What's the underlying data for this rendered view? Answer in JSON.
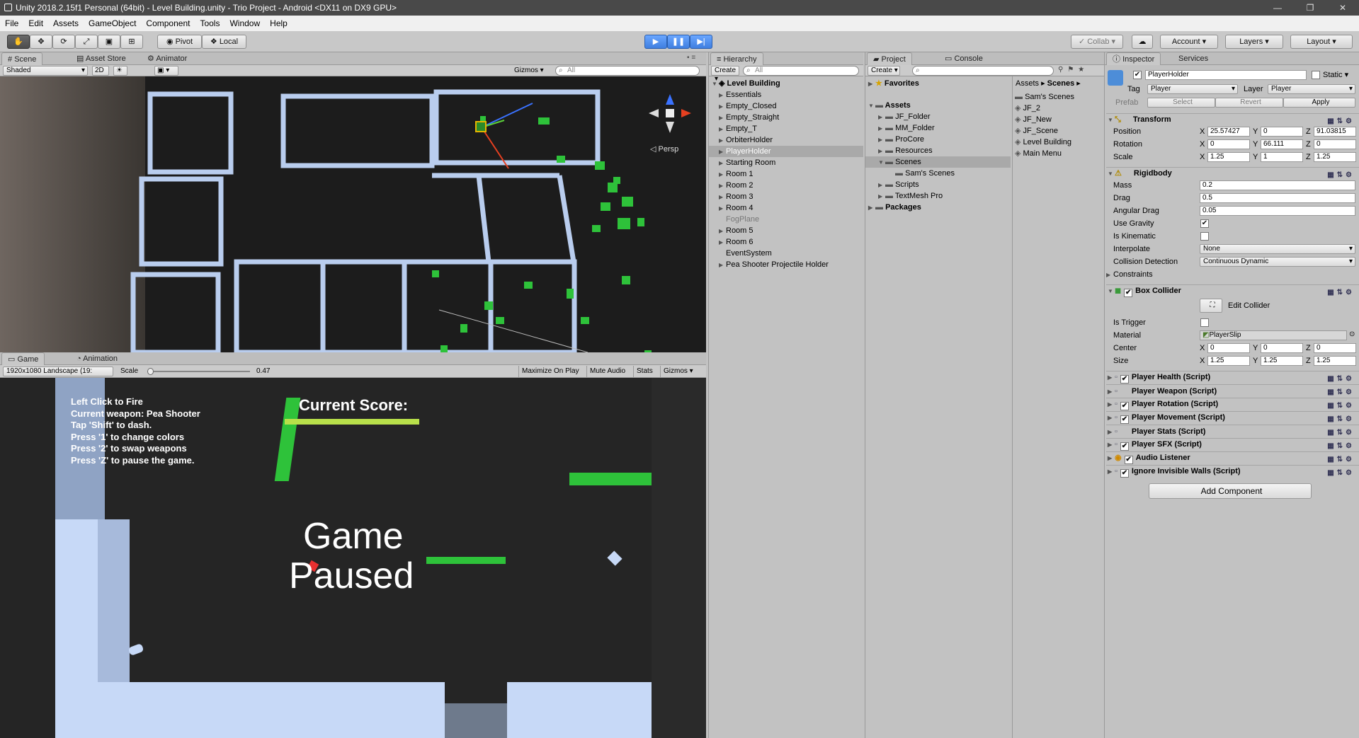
{
  "window": {
    "title": "Unity 2018.2.15f1 Personal (64bit) - Level Building.unity - Trio Project - Android <DX11 on DX9 GPU>",
    "minimize": "—",
    "maximize": "❐",
    "close": "✕"
  },
  "menu": [
    "File",
    "Edit",
    "Assets",
    "GameObject",
    "Component",
    "Tools",
    "Window",
    "Help"
  ],
  "toolbar": {
    "pivot": "Pivot",
    "local": "Local",
    "collab": "Collab",
    "account": "Account",
    "layers": "Layers",
    "layout": "Layout"
  },
  "scene_view": {
    "tabs": [
      "Scene",
      "Asset Store",
      "Animator"
    ],
    "shading": "Shaded",
    "mode_2d": "2D",
    "gizmos": "Gizmos",
    "search_placeholder": "All",
    "persp": "Persp"
  },
  "game_view": {
    "tabs": [
      "Game",
      "Animation"
    ],
    "resolution": "1920x1080 Landscape (19:",
    "scale_label": "Scale",
    "scale_value": "0.47",
    "scale_fraction": 0.47,
    "maximize_on_play": "Maximize On Play",
    "mute_audio": "Mute Audio",
    "stats": "Stats",
    "gizmos": "Gizmos",
    "hud_lines": [
      "Left Click to Fire",
      "Current weapon: Pea Shooter",
      "Tap 'Shift' to dash.",
      "Press '1' to change colors",
      "Press '2' to swap weapons",
      "Press 'Z' to pause the game."
    ],
    "score_label": "Current Score:",
    "pause_line1": "Game",
    "pause_line2": "Paused"
  },
  "hierarchy": {
    "tab": "Hierarchy",
    "create": "Create",
    "search_placeholder": "All",
    "scene_name": "Level Building",
    "items": [
      {
        "label": "Essentials",
        "expandable": true
      },
      {
        "label": "Empty_Closed",
        "expandable": true
      },
      {
        "label": "Empty_Straight",
        "expandable": true
      },
      {
        "label": "Empty_T",
        "expandable": true
      },
      {
        "label": "OrbiterHolder",
        "expandable": true
      },
      {
        "label": "PlayerHolder",
        "expandable": true,
        "selected": true
      },
      {
        "label": "Starting Room",
        "expandable": true
      },
      {
        "label": "Room 1",
        "expandable": true
      },
      {
        "label": "Room 2",
        "expandable": true
      },
      {
        "label": "Room 3",
        "expandable": true
      },
      {
        "label": "Room 4",
        "expandable": true
      },
      {
        "label": "FogPlane",
        "expandable": false,
        "disabled": true
      },
      {
        "label": "Room 5",
        "expandable": true
      },
      {
        "label": "Room 6",
        "expandable": true
      },
      {
        "label": "EventSystem",
        "expandable": false
      },
      {
        "label": "Pea Shooter Projectile Holder",
        "expandable": true
      }
    ]
  },
  "project": {
    "tabs": [
      "Project",
      "Console"
    ],
    "create": "Create",
    "favorites": "Favorites",
    "assets": "Assets",
    "folders": [
      "JF_Folder",
      "MM_Folder",
      "ProCore",
      "Resources",
      "Scenes",
      "Sam's Scenes",
      "Scripts",
      "TextMesh Pro"
    ],
    "packages": "Packages",
    "breadcrumb": [
      "Assets",
      "Scenes"
    ],
    "files": [
      "Sam's Scenes",
      "JF_2",
      "JF_New",
      "JF_Scene",
      "Level Building",
      "Main Menu"
    ]
  },
  "inspector": {
    "tabs": [
      "Inspector",
      "Services"
    ],
    "object_name": "PlayerHolder",
    "static_label": "Static",
    "tag_label": "Tag",
    "tag_value": "Player",
    "layer_label": "Layer",
    "layer_value": "Player",
    "prefab_label": "Prefab",
    "prefab_select": "Select",
    "prefab_revert": "Revert",
    "prefab_apply": "Apply",
    "transform": {
      "title": "Transform",
      "position_label": "Position",
      "position": [
        "25.57427",
        "0",
        "91.03815"
      ],
      "rotation_label": "Rotation",
      "rotation": [
        "0",
        "66.111",
        "0"
      ],
      "scale_label": "Scale",
      "scale": [
        "1.25",
        "1",
        "1.25"
      ]
    },
    "rigidbody": {
      "title": "Rigidbody",
      "mass_label": "Mass",
      "mass": "0.2",
      "drag_label": "Drag",
      "drag": "0.5",
      "angular_drag_label": "Angular Drag",
      "angular_drag": "0.05",
      "use_gravity_label": "Use Gravity",
      "is_kinematic_label": "Is Kinematic",
      "interpolate_label": "Interpolate",
      "interpolate": "None",
      "collision_label": "Collision Detection",
      "collision": "Continuous Dynamic",
      "constraints_label": "Constraints"
    },
    "box_collider": {
      "title": "Box Collider",
      "edit_collider": "Edit Collider",
      "is_trigger_label": "Is Trigger",
      "material_label": "Material",
      "material": "PlayerSlip",
      "center_label": "Center",
      "center": [
        "0",
        "0",
        "0"
      ],
      "size_label": "Size",
      "size": [
        "1.25",
        "1.25",
        "1.25"
      ]
    },
    "scripts": [
      {
        "label": "Player Health (Script)",
        "checked": true
      },
      {
        "label": "Player Weapon (Script)",
        "checked": false
      },
      {
        "label": "Player Rotation (Script)",
        "checked": true
      },
      {
        "label": "Player Movement (Script)",
        "checked": true
      },
      {
        "label": "Player Stats (Script)",
        "checked": false
      },
      {
        "label": "Player SFX (Script)",
        "checked": true
      },
      {
        "label": "Audio Listener",
        "checked": true
      },
      {
        "label": "Ignore Invisible Walls (Script)",
        "checked": true
      }
    ],
    "add_component": "Add Component",
    "axis": [
      "X",
      "Y",
      "Z"
    ]
  },
  "colors": {
    "editor_bg": "#c2c2c2",
    "play_blue": "#3f7fe0",
    "scene_bg": "#1c1c1c",
    "wall": "#b9cdee",
    "green": "#2ec23a",
    "selection": "#a9a9a9"
  }
}
